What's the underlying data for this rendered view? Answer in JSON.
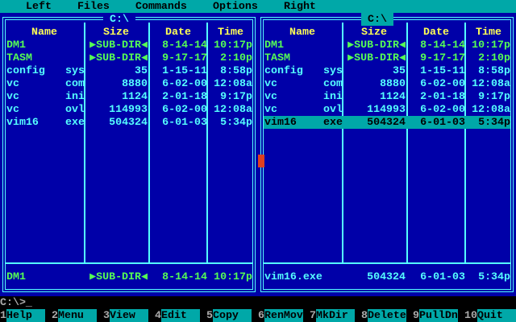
{
  "menu": [
    "Left",
    "Files",
    "Commands",
    "Options",
    "Right"
  ],
  "colors": {
    "panel_bg": "#0000a8",
    "text": "#55ffff",
    "header": "#ffff55",
    "dir": "#55ff55",
    "accent": "#00a8a8"
  },
  "columns": {
    "name": "Name",
    "size": "Size",
    "date": "Date",
    "time": "Time"
  },
  "left": {
    "title": "C:\\",
    "files": [
      {
        "name": "DM1",
        "ext": "",
        "size": "▶SUB-DIR◀",
        "date": "8-14-14",
        "time": "10:17p",
        "dir": true
      },
      {
        "name": "TASM",
        "ext": "",
        "size": "▶SUB-DIR◀",
        "date": "9-17-17",
        "time": "2:10p",
        "dir": true
      },
      {
        "name": "config",
        "ext": "sys",
        "size": "35",
        "date": "1-15-11",
        "time": "8:58p"
      },
      {
        "name": "vc",
        "ext": "com",
        "size": "8880",
        "date": "6-02-00",
        "time": "12:08a"
      },
      {
        "name": "vc",
        "ext": "ini",
        "size": "1124",
        "date": "2-01-18",
        "time": "9:17p"
      },
      {
        "name": "vc",
        "ext": "ovl",
        "size": "114993",
        "date": "6-02-00",
        "time": "12:08a"
      },
      {
        "name": "vim16",
        "ext": "exe",
        "size": "504324",
        "date": "6-01-03",
        "time": "5:34p"
      }
    ],
    "status": {
      "name": "DM1",
      "size": "▶SUB-DIR◀",
      "date": "8-14-14",
      "time": "10:17p"
    }
  },
  "right": {
    "title": "C:\\",
    "selected": 6,
    "files": [
      {
        "name": "DM1",
        "ext": "",
        "size": "▶SUB-DIR◀",
        "date": "8-14-14",
        "time": "10:17p",
        "dir": true
      },
      {
        "name": "TASM",
        "ext": "",
        "size": "▶SUB-DIR◀",
        "date": "9-17-17",
        "time": "2:10p",
        "dir": true
      },
      {
        "name": "config",
        "ext": "sys",
        "size": "35",
        "date": "1-15-11",
        "time": "8:58p"
      },
      {
        "name": "vc",
        "ext": "com",
        "size": "8880",
        "date": "6-02-00",
        "time": "12:08a"
      },
      {
        "name": "vc",
        "ext": "ini",
        "size": "1124",
        "date": "2-01-18",
        "time": "9:17p"
      },
      {
        "name": "vc",
        "ext": "ovl",
        "size": "114993",
        "date": "6-02-00",
        "time": "12:08a"
      },
      {
        "name": "vim16",
        "ext": "exe",
        "size": "504324",
        "date": "6-01-03",
        "time": "5:34p"
      }
    ],
    "status": {
      "name": "vim16.exe",
      "size": "504324",
      "date": "6-01-03",
      "time": "5:34p"
    }
  },
  "prompt": "C:\\>_",
  "keys": [
    {
      "n": "1",
      "l": "Help"
    },
    {
      "n": "2",
      "l": "Menu"
    },
    {
      "n": "3",
      "l": "View"
    },
    {
      "n": "4",
      "l": "Edit"
    },
    {
      "n": "5",
      "l": "Copy"
    },
    {
      "n": "6",
      "l": "RenMov"
    },
    {
      "n": "7",
      "l": "MkDir"
    },
    {
      "n": "8",
      "l": "Delete"
    },
    {
      "n": "9",
      "l": "PullDn"
    },
    {
      "n": "10",
      "l": "Quit"
    }
  ]
}
